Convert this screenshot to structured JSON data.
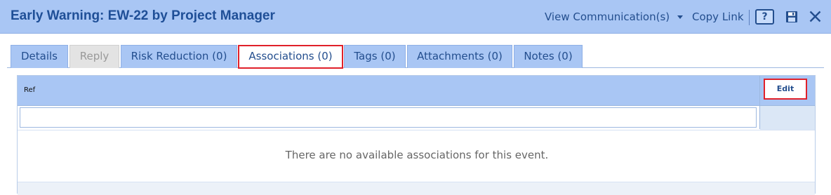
{
  "header": {
    "title": "Early Warning: EW-22 by Project Manager",
    "view_communications": "View Communication(s)",
    "copy_link": "Copy Link",
    "help_glyph": "?",
    "icons": [
      "help-icon",
      "save-icon",
      "close-icon",
      "caret-down-icon"
    ]
  },
  "tabs": [
    {
      "label": "Details",
      "state": "normal"
    },
    {
      "label": "Reply",
      "state": "disabled"
    },
    {
      "label": "Risk Reduction (0)",
      "state": "normal"
    },
    {
      "label": "Associations (0)",
      "state": "active"
    },
    {
      "label": "Tags (0)",
      "state": "normal"
    },
    {
      "label": "Attachments (0)",
      "state": "normal"
    },
    {
      "label": "Notes (0)",
      "state": "normal"
    }
  ],
  "grid": {
    "column_ref": "Ref",
    "edit_label": "Edit",
    "filter_value": "",
    "empty_message": "There are no available associations for this event."
  },
  "colors": {
    "header_bg": "#a9c6f4",
    "title_text": "#1f4f97",
    "link_text": "#234e8e",
    "highlight": "#e0202a"
  }
}
